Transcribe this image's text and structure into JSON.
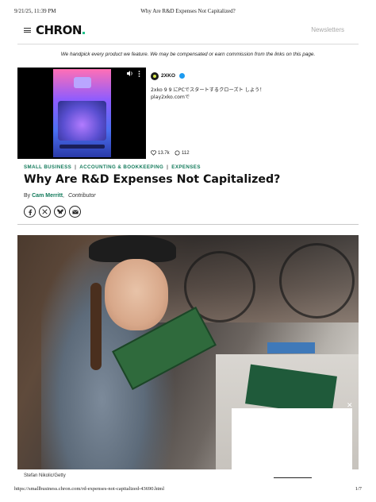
{
  "print_header": {
    "timestamp": "9/21/25, 11:39 PM",
    "page_title": "Why Are R&D Expenses Not Capitalized?"
  },
  "site": {
    "logo": "CHRON",
    "logo_accent_color": "#21c28b",
    "newsletters_label": "Newsletters",
    "menu_icon": "hamburger-icon"
  },
  "disclaimer": "We handpick every product we feature. We may be compensated or earn commission from the links on this page.",
  "social_embed": {
    "account_name": "2XKO",
    "verified_icon": "verified-badge-icon",
    "post_text": "2xko 9 9 にPCでスタートするクローズト しよう！play2xko.comで",
    "likes": "13.7k",
    "replies": "112",
    "like_icon": "heart-icon",
    "reply_icon": "comment-icon",
    "video_icons": [
      "volume-icon",
      "more-options-icon"
    ]
  },
  "categories": [
    "SMALL BUSINESS",
    "ACCOUNTING & BOOKKEEPING",
    "EXPENSES"
  ],
  "category_separator": "|",
  "category_color": "#127a5a",
  "article": {
    "headline": "Why Are R&D Expenses Not Capitalized?",
    "by_prefix": "By",
    "author": "Cam Merritt",
    "author_suffix": ",",
    "author_role": "Contributor"
  },
  "share_buttons": [
    {
      "icon": "facebook-icon"
    },
    {
      "icon": "x-icon"
    },
    {
      "icon": "bluesky-icon"
    },
    {
      "icon": "email-icon"
    }
  ],
  "image": {
    "caption": "Stefan Nikolic/Getty",
    "ad_close": "✕"
  },
  "print_footer": {
    "url": "https://smallbusiness.chron.com/rd-expenses-not-capitalized-43690.html",
    "page": "1/7"
  }
}
